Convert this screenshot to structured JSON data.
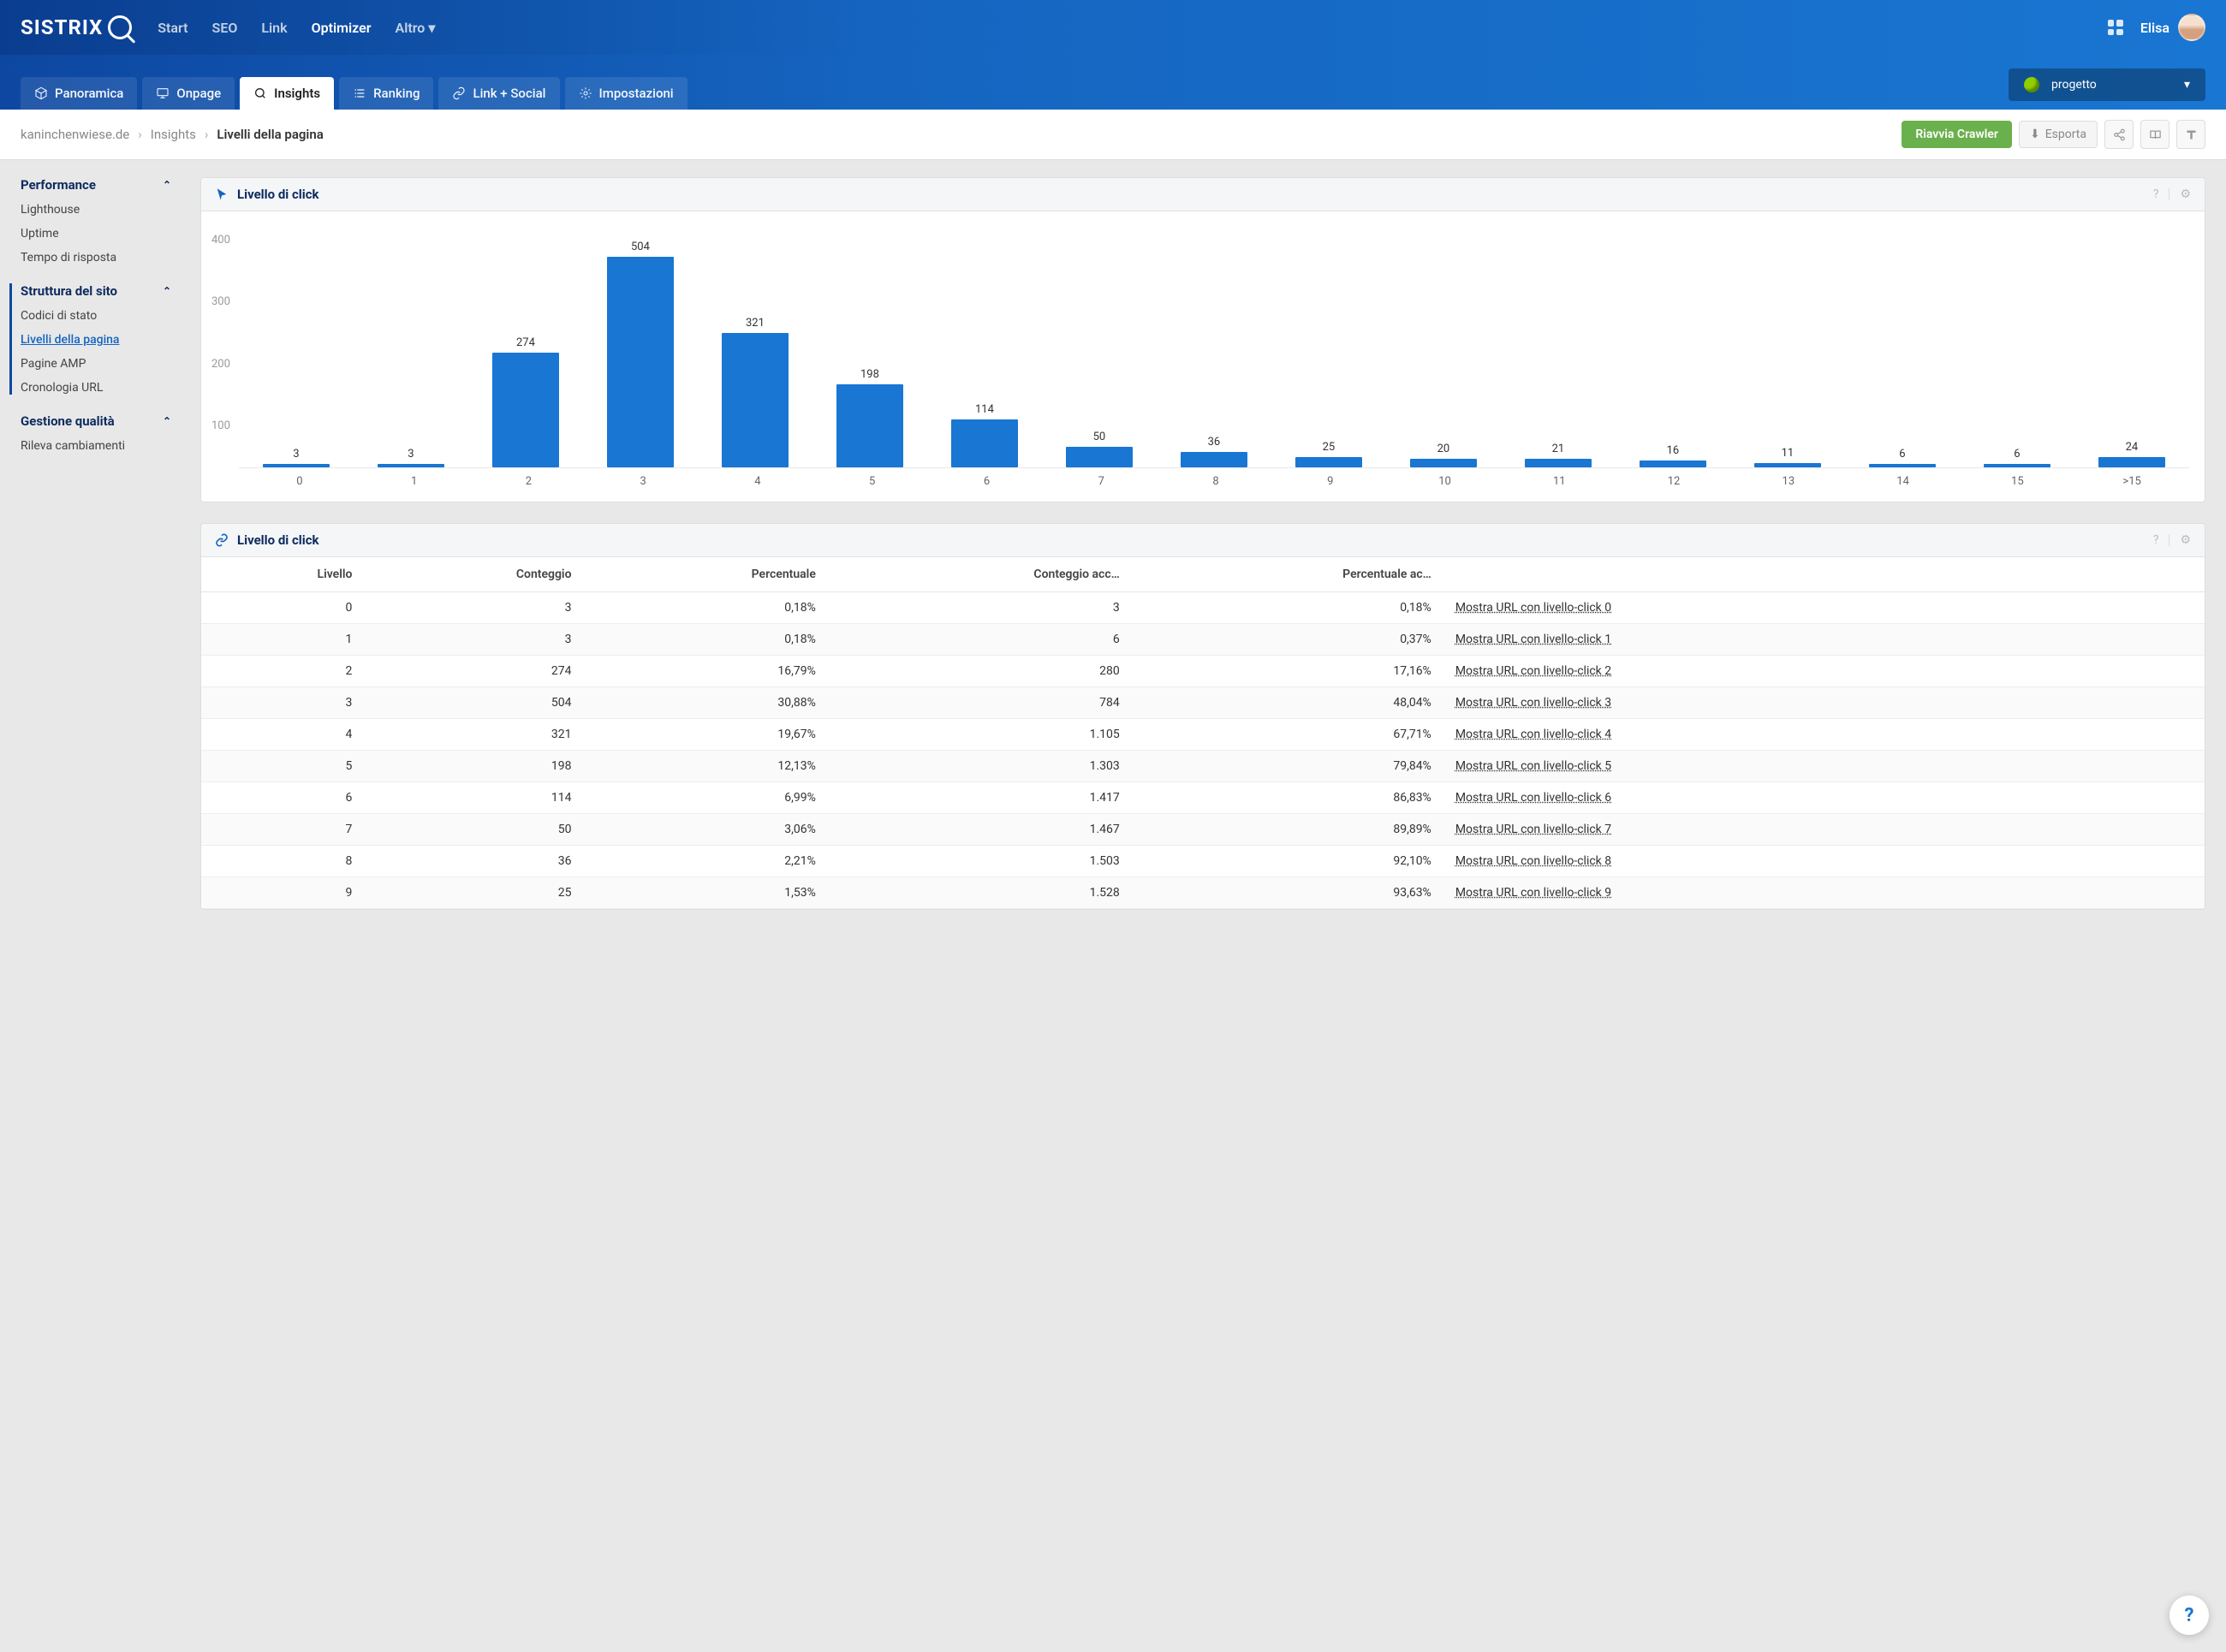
{
  "brand": "SISTRIX",
  "topnav": {
    "items": [
      "Start",
      "SEO",
      "Link",
      "Optimizer",
      "Altro"
    ],
    "active": "Optimizer"
  },
  "user": {
    "name": "Elisa"
  },
  "tabs": {
    "items": [
      {
        "icon": "cube",
        "label": "Panoramica"
      },
      {
        "icon": "monitor",
        "label": "Onpage"
      },
      {
        "icon": "search",
        "label": "Insights"
      },
      {
        "icon": "list",
        "label": "Ranking"
      },
      {
        "icon": "link",
        "label": "Link + Social"
      },
      {
        "icon": "gear",
        "label": "Impostazioni"
      }
    ],
    "active": "Insights"
  },
  "project_select": {
    "label": "progetto"
  },
  "breadcrumb": {
    "domain": "kaninchenwiese.de",
    "section": "Insights",
    "current": "Livelli della pagina"
  },
  "actions": {
    "restart_crawler": "Riavvia Crawler",
    "export": "Esporta"
  },
  "sidebar": {
    "sections": [
      {
        "title": "Performance",
        "items": [
          "Lighthouse",
          "Uptime",
          "Tempo di risposta"
        ],
        "active_section": false
      },
      {
        "title": "Struttura del sito",
        "items": [
          "Codici di stato",
          "Livelli della pagina",
          "Pagine AMP",
          "Cronologia URL"
        ],
        "active_section": true,
        "active_item": "Livelli della pagina"
      },
      {
        "title": "Gestione qualità",
        "items": [
          "Rileva cambiamenti"
        ],
        "active_section": false
      }
    ]
  },
  "chart_card": {
    "title": "Livello di click"
  },
  "table_card": {
    "title": "Livello di click",
    "headers": [
      "Livello",
      "Conteggio",
      "Percentuale",
      "Conteggio acc…",
      "Percentuale ac…",
      ""
    ],
    "link_prefix": "Mostra URL con livello-click ",
    "rows": [
      {
        "level": "0",
        "count": "3",
        "pct": "0,18%",
        "acc_count": "3",
        "acc_pct": "0,18%"
      },
      {
        "level": "1",
        "count": "3",
        "pct": "0,18%",
        "acc_count": "6",
        "acc_pct": "0,37%"
      },
      {
        "level": "2",
        "count": "274",
        "pct": "16,79%",
        "acc_count": "280",
        "acc_pct": "17,16%"
      },
      {
        "level": "3",
        "count": "504",
        "pct": "30,88%",
        "acc_count": "784",
        "acc_pct": "48,04%"
      },
      {
        "level": "4",
        "count": "321",
        "pct": "19,67%",
        "acc_count": "1.105",
        "acc_pct": "67,71%"
      },
      {
        "level": "5",
        "count": "198",
        "pct": "12,13%",
        "acc_count": "1.303",
        "acc_pct": "79,84%"
      },
      {
        "level": "6",
        "count": "114",
        "pct": "6,99%",
        "acc_count": "1.417",
        "acc_pct": "86,83%"
      },
      {
        "level": "7",
        "count": "50",
        "pct": "3,06%",
        "acc_count": "1.467",
        "acc_pct": "89,89%"
      },
      {
        "level": "8",
        "count": "36",
        "pct": "2,21%",
        "acc_count": "1.503",
        "acc_pct": "92,10%"
      },
      {
        "level": "9",
        "count": "25",
        "pct": "1,53%",
        "acc_count": "1.528",
        "acc_pct": "93,63%"
      }
    ]
  },
  "chart_data": {
    "type": "bar",
    "title": "Livello di click",
    "xlabel": "",
    "ylabel": "",
    "ylim": [
      0,
      450
    ],
    "y_ticks": [
      400,
      300,
      200,
      100
    ],
    "categories": [
      "0",
      "1",
      "2",
      "3",
      "4",
      "5",
      "6",
      "7",
      "8",
      "9",
      "10",
      "11",
      "12",
      "13",
      "14",
      "15",
      ">15"
    ],
    "values": [
      3,
      3,
      274,
      504,
      321,
      198,
      114,
      50,
      36,
      25,
      20,
      21,
      16,
      11,
      6,
      6,
      24
    ]
  }
}
